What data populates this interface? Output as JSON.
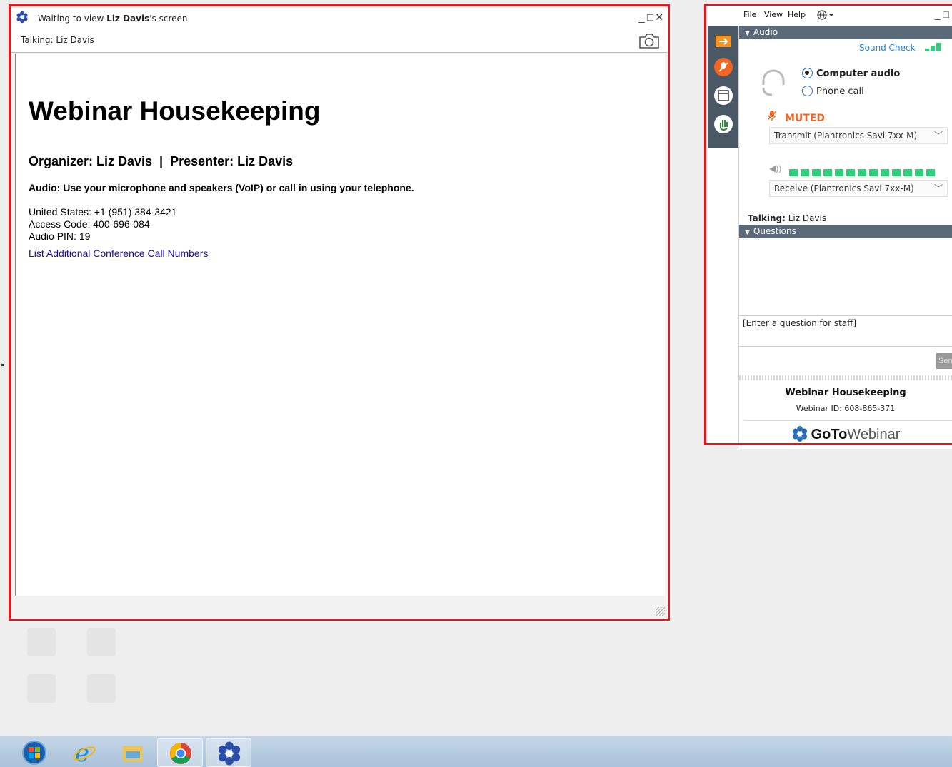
{
  "viewer": {
    "title_prefix": "Waiting to view ",
    "title_name": "Liz Davis",
    "title_suffix": "'s screen",
    "talking": "Talking: Liz Davis",
    "controls": [
      "_",
      "□",
      "✕"
    ]
  },
  "slide": {
    "title": "Webinar Housekeeping",
    "subtitle": "Organizer: Liz Davis  |  Presenter: Liz Davis",
    "audio_line": "Audio: Use your microphone and speakers (VoIP) or call in using your telephone.",
    "phone": "United States: +1 (951) 384-3421",
    "access_code": "Access Code: 400-696-084",
    "audio_pin": "Audio PIN: 19",
    "link": "List Additional Conference Call Numbers"
  },
  "panel": {
    "menu": [
      "File",
      "View",
      "Help"
    ],
    "globe_icon": "globe-icon",
    "audio_section": "Audio",
    "sound_check": "Sound Check",
    "computer_audio": "Computer audio",
    "phone_call": "Phone call",
    "selected_audio": "Computer audio",
    "muted": "MUTED",
    "transmit": "Transmit (Plantronics Savi 7xx-M)",
    "receive": "Receive (Plantronics Savi 7xx-M)",
    "talking_label": "Talking:",
    "talking_name": "Liz Davis",
    "questions_section": "Questions",
    "question_placeholder": "[Enter a question for staff]",
    "send": "Send",
    "webinar_name": "Webinar Housekeeping",
    "webinar_id": "Webinar ID: 608-865-371",
    "brand_go": "GoTo",
    "brand_webinar": "Webinar"
  },
  "colors": {
    "highlight_border": "#e8141b",
    "muted_orange": "#f26522",
    "section_header": "#5a6a79",
    "meter_green": "#2ed07a",
    "link_blue": "#1a0dab"
  },
  "taskbar": {
    "items": [
      "windows-start-icon",
      "internet-explorer-icon",
      "file-explorer-icon",
      "chrome-icon",
      "gotowebinar-icon"
    ]
  }
}
